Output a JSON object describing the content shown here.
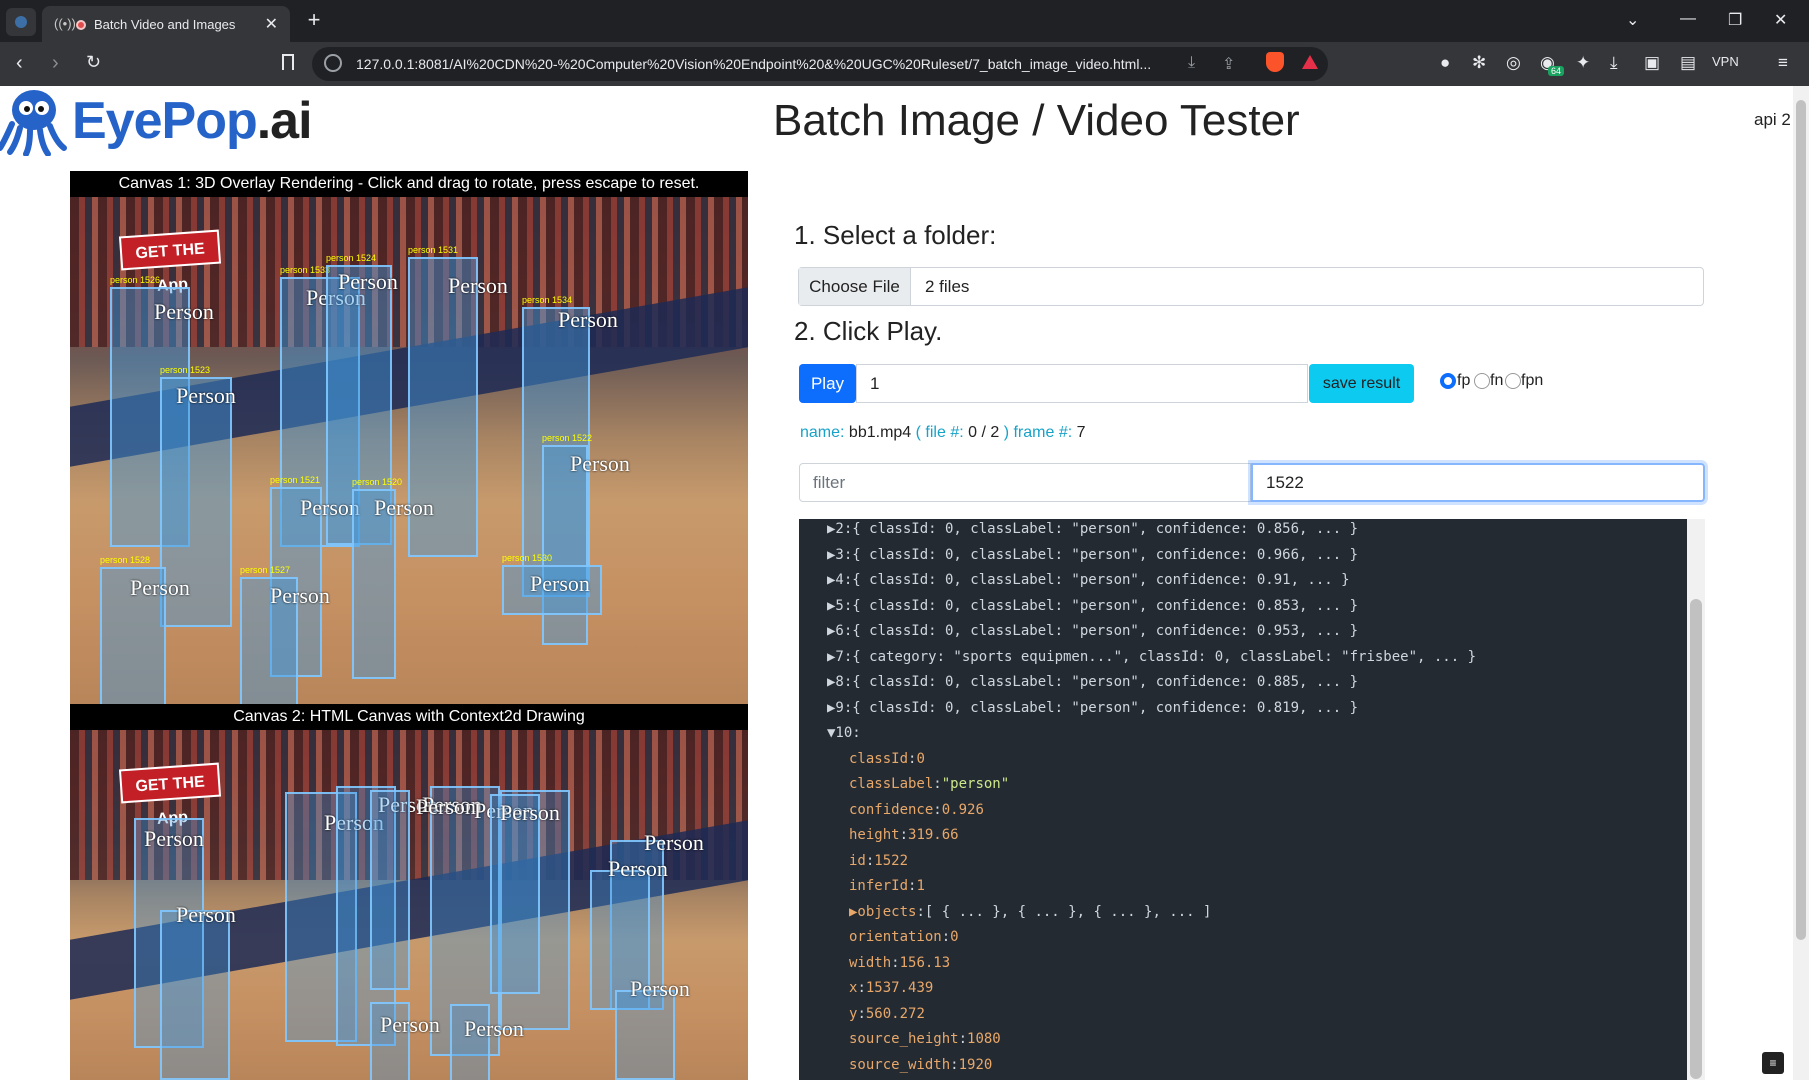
{
  "browser": {
    "tab_title": "Batch Video and Images",
    "url": "127.0.0.1:8081/AI%20CDN%20-%20Computer%20Vision%20Endpoint%20&%20UGC%20Ruleset/7_batch_image_video.html...",
    "vpn_label": "VPN",
    "ext_badge": "64"
  },
  "header": {
    "logo_word": "EyePop",
    "logo_suffix": ".ai",
    "title": "Batch Image / Video Tester",
    "api_label": "api 2"
  },
  "canvas1": {
    "caption": "Canvas 1: 3D Overlay Rendering - Click and drag to rotate, press escape to reset.",
    "adboard": "GET THE App",
    "detections": [
      {
        "label": "Person",
        "tag": "person 1526"
      },
      {
        "label": "Person",
        "tag": "person 1533"
      },
      {
        "label": "Person",
        "tag": "person 1524"
      },
      {
        "label": "Person",
        "tag": "person 1531"
      },
      {
        "label": "Person",
        "tag": "person 1534"
      },
      {
        "label": "Person",
        "tag": "person 1523"
      },
      {
        "label": "Person",
        "tag": "person 1522"
      },
      {
        "label": "Person",
        "tag": "person 1521"
      },
      {
        "label": "Person",
        "tag": "person 1520"
      },
      {
        "label": "Person",
        "tag": "person 1528"
      },
      {
        "label": "Person",
        "tag": "person 1527"
      },
      {
        "label": "Person",
        "tag": "person 1530"
      }
    ]
  },
  "canvas2": {
    "caption": "Canvas 2: HTML Canvas with Context2d Drawing",
    "adboard": "GET THE App",
    "labels": [
      "Person",
      "Person",
      "Person",
      "Person",
      "Person",
      "Person",
      "Person",
      "Person",
      "Person",
      "Person",
      "Person",
      "Person",
      "Person"
    ]
  },
  "controls": {
    "step1": "1. Select a folder:",
    "choose_file": "Choose File",
    "files_text": "2 files",
    "step2": "2. Click Play.",
    "play": "Play",
    "frame_value": "1",
    "save_result": "save result",
    "radio_options": [
      "fp",
      "fn",
      "fpn"
    ],
    "radio_selected": "fp",
    "filter_placeholder": "filter",
    "id_filter_value": "1522"
  },
  "status": {
    "name_key": "name:",
    "name_value": "bb1.mp4",
    "file_key_open": "( file #:",
    "file_value": "0 / 2",
    "close_paren": ")",
    "frame_key": "frame #:",
    "frame_value": "7"
  },
  "json_view": {
    "collapsed_rows": [
      "▶2:{ classId: 0, classLabel: \"person\", confidence: 0.856, ... }",
      "▶3:{ classId: 0, classLabel: \"person\", confidence: 0.966, ... }",
      "▶4:{ classId: 0, classLabel: \"person\", confidence: 0.91, ... }",
      "▶5:{ classId: 0, classLabel: \"person\", confidence: 0.853, ... }",
      "▶6:{ classId: 0, classLabel: \"person\", confidence: 0.953, ... }",
      "▶7:{ category: \"sports equipmen...\", classId: 0, classLabel: \"frisbee\", ... }",
      "▶8:{ classId: 0, classLabel: \"person\", confidence: 0.885, ... }",
      "▶9:{ classId: 0, classLabel: \"person\", confidence: 0.819, ... }"
    ],
    "expanded_header": "▼10:",
    "expanded_fields": [
      {
        "key": "classId",
        "value": "0"
      },
      {
        "key": "classLabel",
        "value": "\"person\""
      },
      {
        "key": "confidence",
        "value": "0.926"
      },
      {
        "key": "height",
        "value": "319.66"
      },
      {
        "key": "id",
        "value": "1522"
      },
      {
        "key": "inferId",
        "value": "1"
      },
      {
        "key": "▶objects",
        "value": "[ { ... }, { ... }, { ... }, ... ]"
      },
      {
        "key": "orientation",
        "value": "0"
      },
      {
        "key": "width",
        "value": "156.13"
      },
      {
        "key": "x",
        "value": "1537.439"
      },
      {
        "key": "y",
        "value": "560.272"
      },
      {
        "key": "source_height",
        "value": "1080"
      },
      {
        "key": "source_width",
        "value": "1920"
      }
    ]
  }
}
